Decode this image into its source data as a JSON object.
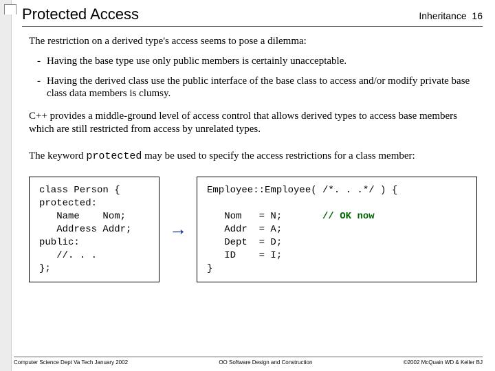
{
  "header": {
    "title": "Protected Access",
    "section": "Inheritance",
    "page": "16"
  },
  "intro": "The restriction on a derived type's access seems to pose a dilemma:",
  "bullets": [
    "Having the base type use only public members is certainly unacceptable.",
    "Having the derived class use the public interface of the base class to access and/or modify private base class data members is clumsy."
  ],
  "para1": "C++ provides a middle-ground level of access control that allows derived types to access base members which are still restricted from access by unrelated types.",
  "para2_a": "The keyword ",
  "para2_kw": "protected",
  "para2_b": " may be used to specify the access restrictions for a class member:",
  "code_left": "class Person {\nprotected:\n   Name    Nom;\n   Address Addr;\npublic:\n   //. . .\n};",
  "code_right_line1": "Employee::Employee( /*. . .*/ ) {",
  "code_right_body": "   Nom   = N;       ",
  "code_right_comment": "// OK now",
  "code_right_rest": "   Addr  = A;\n   Dept  = D;\n   ID    = I;\n}",
  "footer": {
    "left": "Computer Science Dept Va Tech January 2002",
    "center": "OO Software Design and Construction",
    "right": "©2002 McQuain WD & Keller BJ"
  }
}
